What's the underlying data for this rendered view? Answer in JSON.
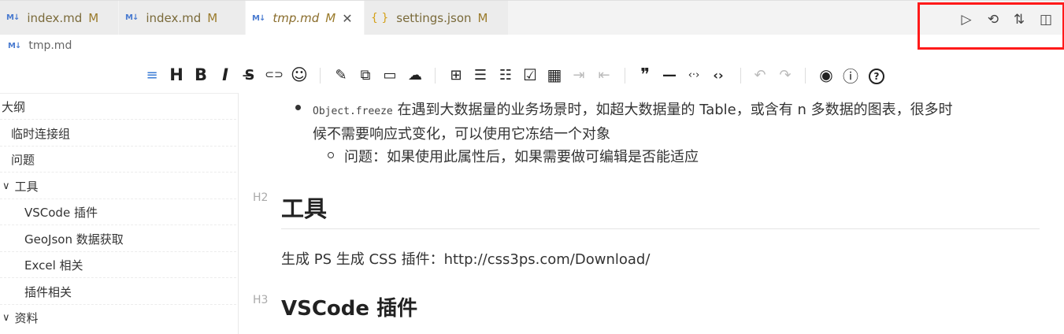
{
  "tabs": [
    {
      "icon": "M↓",
      "name": "index.md",
      "status": "M"
    },
    {
      "icon": "M↓",
      "name": "index.md",
      "status": "M"
    },
    {
      "icon": "M↓",
      "name": "tmp.md",
      "status": "M",
      "close": "✕"
    },
    {
      "icon": "{ }",
      "name": "settings.json",
      "status": "M"
    }
  ],
  "tab_actions": {
    "run": "▷",
    "history": "⟲",
    "compare": "⇅",
    "split": "◫"
  },
  "breadcrumb": {
    "icon": "M↓",
    "file": "tmp.md"
  },
  "toolbar": {
    "align": "≡",
    "heading": "H",
    "bold": "B",
    "italic": "I",
    "strike": "S̶",
    "link": "⊂⊃",
    "emoji": "☺",
    "edit": "✎",
    "copy": "⧉",
    "paste": "▭",
    "upload": "☁",
    "insert": "⊞",
    "ul": "☰",
    "ol": "☷",
    "task": "☑",
    "table": "▦",
    "indent": "⇥",
    "outdent": "⇤",
    "quote": "❞",
    "hr": "—",
    "inline_code": "‹·›",
    "code": "‹›",
    "undo": "↶",
    "redo": "↷",
    "preview": "◉",
    "info": "ⓘ",
    "help": "?"
  },
  "outline": {
    "title": "大纲",
    "items": [
      {
        "label": "临时连接组"
      },
      {
        "label": "问题"
      },
      {
        "label": "工具",
        "chevron": "∨"
      },
      {
        "label": "VSCode 插件"
      },
      {
        "label": "GeoJson 数据获取"
      },
      {
        "label": "Excel 相关"
      },
      {
        "label": "插件相关"
      },
      {
        "label": "资料",
        "chevron": "∨"
      }
    ]
  },
  "content": {
    "bullet1_code": "Object.freeze",
    "bullet1_text": " 在遇到大数据量的业务场景时，如超大数据量的 Table，或含有 n 多数据的图表，很多时",
    "bullet1_cont": "候不需要响应式变化，可以使用它冻结一个对象",
    "sub_bullet": "问题：如果使用此属性后，如果需要做可编辑是否能适应",
    "h2_mark": "H2",
    "h2_title": "工具",
    "para": "生成 PS 生成 CSS 插件：http://css3ps.com/Download/",
    "h3_mark": "H3",
    "h3_title": "VSCode 插件"
  }
}
